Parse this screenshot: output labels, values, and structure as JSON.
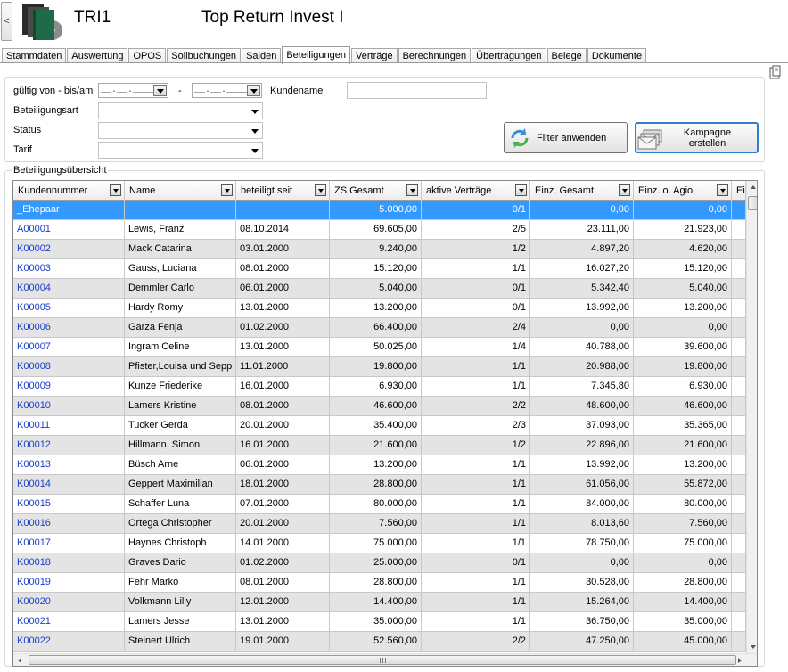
{
  "header": {
    "back_glyph": "<",
    "code": "TRI1",
    "company": "Top Return Invest I",
    "logo_icon": "folders-disc-icon"
  },
  "tabs": [
    {
      "label": "Stammdaten",
      "active": false
    },
    {
      "label": "Auswertung",
      "active": false
    },
    {
      "label": "OPOS",
      "active": false
    },
    {
      "label": "Sollbuchungen",
      "active": false
    },
    {
      "label": "Salden",
      "active": false
    },
    {
      "label": "Beteiligungen",
      "active": true
    },
    {
      "label": "Verträge",
      "active": false
    },
    {
      "label": "Berechnungen",
      "active": false
    },
    {
      "label": "Übertragungen",
      "active": false
    },
    {
      "label": "Belege",
      "active": false
    },
    {
      "label": "Dokumente",
      "active": false
    }
  ],
  "filter": {
    "valid_label": "gültig von - bis/am",
    "date_from": "__.__.____",
    "date_sep": "-",
    "date_to": "__.__.____",
    "customer_label": "Kundename",
    "customer_value": "",
    "participation_type_label": "Beteiligungsart",
    "status_label": "Status",
    "tariff_label": "Tarif",
    "apply_button": "Filter anwenden",
    "campaign_button_line1": "Kampagne",
    "campaign_button_line2": "erstellen"
  },
  "grid": {
    "panel_title": "Beteiligungsübersicht",
    "columns": [
      "Kundennummer",
      "Name",
      "beteiligt seit",
      "ZS Gesamt",
      "aktive Verträge",
      "Einz. Gesamt",
      "Einz. o. Agio",
      "Ein"
    ],
    "selection_color": "#3399ff",
    "link_color": "#1a3fc8",
    "rows": [
      {
        "nr": "_Ehepaar",
        "name": "",
        "since": "",
        "zs": "5.000,00",
        "active": "0/1",
        "einz": "0,00",
        "agio": "0,00",
        "selected": true
      },
      {
        "nr": "A00001",
        "name": "Lewis, Franz",
        "since": "08.10.2014",
        "zs": "69.605,00",
        "active": "2/5",
        "einz": "23.111,00",
        "agio": "21.923,00"
      },
      {
        "nr": "K00002",
        "name": "Mack Catarina",
        "since": "03.01.2000",
        "zs": "9.240,00",
        "active": "1/2",
        "einz": "4.897,20",
        "agio": "4.620,00"
      },
      {
        "nr": "K00003",
        "name": "Gauss, Luciana",
        "since": "08.01.2000",
        "zs": "15.120,00",
        "active": "1/1",
        "einz": "16.027,20",
        "agio": "15.120,00"
      },
      {
        "nr": "K00004",
        "name": "Demmler Carlo",
        "since": "06.01.2000",
        "zs": "5.040,00",
        "active": "0/1",
        "einz": "5.342,40",
        "agio": "5.040,00"
      },
      {
        "nr": "K00005",
        "name": "Hardy Romy",
        "since": "13.01.2000",
        "zs": "13.200,00",
        "active": "0/1",
        "einz": "13.992,00",
        "agio": "13.200,00"
      },
      {
        "nr": "K00006",
        "name": "Garza Fenja",
        "since": "01.02.2000",
        "zs": "66.400,00",
        "active": "2/4",
        "einz": "0,00",
        "agio": "0,00"
      },
      {
        "nr": "K00007",
        "name": "Ingram Celine",
        "since": "13.01.2000",
        "zs": "50.025,00",
        "active": "1/4",
        "einz": "40.788,00",
        "agio": "39.600,00"
      },
      {
        "nr": "K00008",
        "name": "Pfister,Louisa und Sepp",
        "since": "11.01.2000",
        "zs": "19.800,00",
        "active": "1/1",
        "einz": "20.988,00",
        "agio": "19.800,00"
      },
      {
        "nr": "K00009",
        "name": "Kunze Friederike",
        "since": "16.01.2000",
        "zs": "6.930,00",
        "active": "1/1",
        "einz": "7.345,80",
        "agio": "6.930,00"
      },
      {
        "nr": "K00010",
        "name": "Lamers Kristine",
        "since": "08.01.2000",
        "zs": "46.600,00",
        "active": "2/2",
        "einz": "48.600,00",
        "agio": "46.600,00"
      },
      {
        "nr": "K00011",
        "name": "Tucker Gerda",
        "since": "20.01.2000",
        "zs": "35.400,00",
        "active": "2/3",
        "einz": "37.093,00",
        "agio": "35.365,00"
      },
      {
        "nr": "K00012",
        "name": "Hillmann, Simon",
        "since": "16.01.2000",
        "zs": "21.600,00",
        "active": "1/2",
        "einz": "22.896,00",
        "agio": "21.600,00"
      },
      {
        "nr": "K00013",
        "name": "Büsch Arne",
        "since": "06.01.2000",
        "zs": "13.200,00",
        "active": "1/1",
        "einz": "13.992,00",
        "agio": "13.200,00"
      },
      {
        "nr": "K00014",
        "name": "Geppert Maximilian",
        "since": "18.01.2000",
        "zs": "28.800,00",
        "active": "1/1",
        "einz": "61.056,00",
        "agio": "55.872,00"
      },
      {
        "nr": "K00015",
        "name": "Schaffer Luna",
        "since": "07.01.2000",
        "zs": "80.000,00",
        "active": "1/1",
        "einz": "84.000,00",
        "agio": "80.000,00"
      },
      {
        "nr": "K00016",
        "name": "Ortega Christopher",
        "since": "20.01.2000",
        "zs": "7.560,00",
        "active": "1/1",
        "einz": "8.013,60",
        "agio": "7.560,00"
      },
      {
        "nr": "K00017",
        "name": "Haynes Christoph",
        "since": "14.01.2000",
        "zs": "75.000,00",
        "active": "1/1",
        "einz": "78.750,00",
        "agio": "75.000,00"
      },
      {
        "nr": "K00018",
        "name": "Graves Dario",
        "since": "01.02.2000",
        "zs": "25.000,00",
        "active": "0/1",
        "einz": "0,00",
        "agio": "0,00"
      },
      {
        "nr": "K00019",
        "name": "Fehr Marko",
        "since": "08.01.2000",
        "zs": "28.800,00",
        "active": "1/1",
        "einz": "30.528,00",
        "agio": "28.800,00"
      },
      {
        "nr": "K00020",
        "name": "Volkmann Lilly",
        "since": "12.01.2000",
        "zs": "14.400,00",
        "active": "1/1",
        "einz": "15.264,00",
        "agio": "14.400,00"
      },
      {
        "nr": "K00021",
        "name": "Lamers Jesse",
        "since": "13.01.2000",
        "zs": "35.000,00",
        "active": "1/1",
        "einz": "36.750,00",
        "agio": "35.000,00"
      },
      {
        "nr": "K00022",
        "name": "Steinert Ulrich",
        "since": "19.01.2000",
        "zs": "52.560,00",
        "active": "2/2",
        "einz": "47.250,00",
        "agio": "45.000,00"
      }
    ]
  }
}
